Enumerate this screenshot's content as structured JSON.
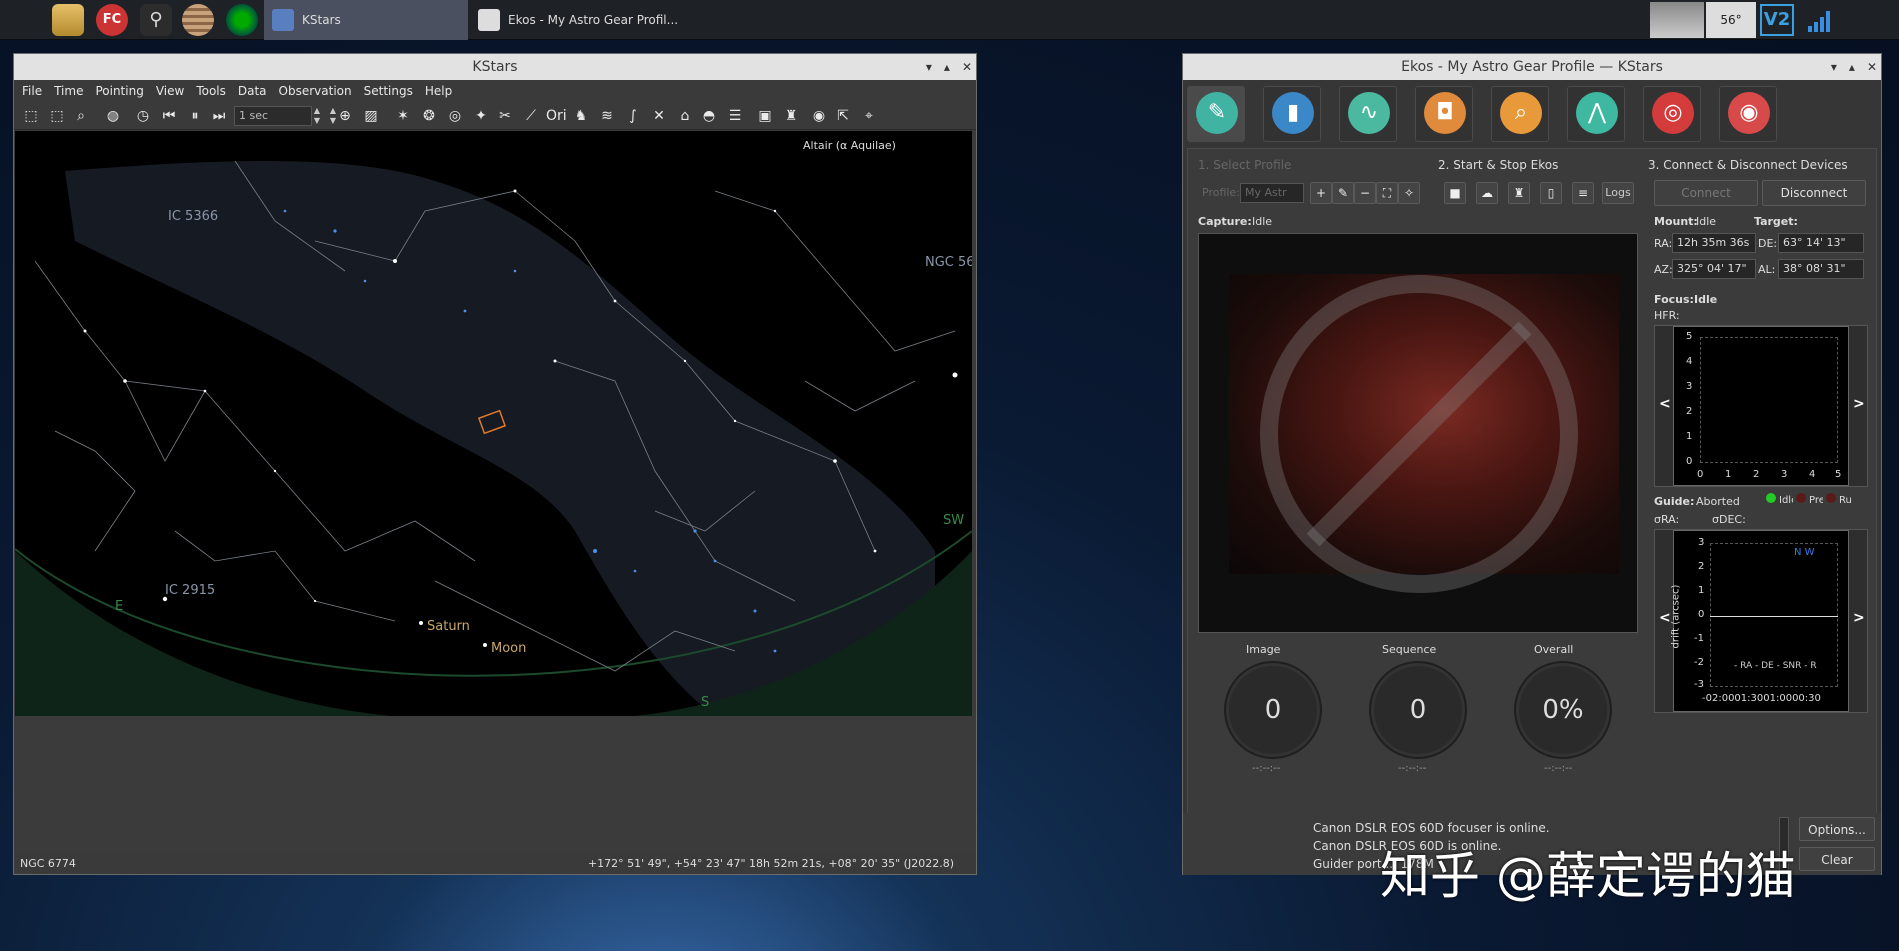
{
  "taskbar": {
    "tasks": [
      {
        "label": "KStars"
      },
      {
        "label": "Ekos - My Astro Gear Profil..."
      }
    ],
    "temp": "56°"
  },
  "kstars": {
    "title": "KStars",
    "menu": [
      "File",
      "Time",
      "Pointing",
      "View",
      "Tools",
      "Data",
      "Observation",
      "Settings",
      "Help"
    ],
    "timestep": "1 sec",
    "sky": {
      "focus": "Altair (α Aquilae)",
      "labels": {
        "ic5366": "IC 5366",
        "ngc56": "NGC 56",
        "ic2915": "IC 2915",
        "saturn": "Saturn",
        "moon": "Moon",
        "e": "E",
        "s": "S",
        "sw": "SW"
      }
    },
    "status_left": "NGC 6774",
    "status_right": "+172° 51' 49\", +54° 23' 47\"  18h 52m 21s, +08° 20' 35\" (J2022.8)"
  },
  "ekos": {
    "title": "Ekos - My Astro Gear Profile — KStars",
    "tabs": [
      {
        "color": "#41b3a3",
        "icon": "wrench-icon"
      },
      {
        "color": "#3a88c8",
        "icon": "scheduler-icon"
      },
      {
        "color": "#4bb8a0",
        "icon": "analyze-icon"
      },
      {
        "color": "#e08a3c",
        "icon": "camera-icon"
      },
      {
        "color": "#e89a3a",
        "icon": "focus-search-icon"
      },
      {
        "color": "#3fb8a2",
        "icon": "mount-icon"
      },
      {
        "color": "#d43b3b",
        "icon": "align-target-icon"
      },
      {
        "color": "#d84a4a",
        "icon": "guide-icon"
      }
    ],
    "section1": "1. Select Profile",
    "section2": "2. Start & Stop Ekos",
    "section3": "3. Connect & Disconnect Devices",
    "profile_label": "Profile:",
    "profile_value": "My Astr",
    "logs_label": "Logs",
    "connect": "Connect",
    "disconnect": "Disconnect",
    "capture_label": "Capture:",
    "capture_status": "Idle",
    "mount_label": "Mount:",
    "mount_status": "Idle",
    "target_label": "Target:",
    "ra_label": "RA:",
    "ra": "12h 35m 36s",
    "de_label": "DE:",
    "de": "63° 14' 13\"",
    "az_label": "AZ:",
    "az": "325° 04' 17\"",
    "al_label": "AL:",
    "al": "38° 08' 31\"",
    "focus_label": "Focus:",
    "focus_status": "Idle",
    "hfr_label": "HFR:",
    "focus_y_ticks": [
      "5",
      "4",
      "3",
      "2",
      "1",
      "0"
    ],
    "focus_x_ticks": [
      "0",
      "1",
      "2",
      "3",
      "4",
      "5"
    ],
    "guide_label": "Guide:",
    "guide_status": "Aborted",
    "guide_states": [
      "Idle",
      "Pre",
      "Ru"
    ],
    "ora": "σRA:",
    "odec": "σDEC:",
    "guide_ylabel": "drift (arcsec)",
    "guide_y_ticks": [
      "3",
      "2",
      "1",
      "0",
      "-1",
      "-2",
      "-3"
    ],
    "guide_x_ticks": "-02:0001:3001:0000:30",
    "guide_nw": "N W",
    "guide_legend": "- RA - DE - SNR - R",
    "image_label": "Image",
    "sequence_label": "Sequence",
    "overall_label": "Overall",
    "image_value": "0",
    "sequence_value": "0",
    "overall_value": "0%",
    "time_placeholder": "--:--:--",
    "logs": [
      "Canon DSLR EOS 60D focuser is online.",
      "Canon DSLR EOS 60D is online.",
      "Guider port  ... 178M"
    ],
    "options": "Options...",
    "clear": "Clear"
  },
  "watermark": "知乎 @薛定谔的猫"
}
